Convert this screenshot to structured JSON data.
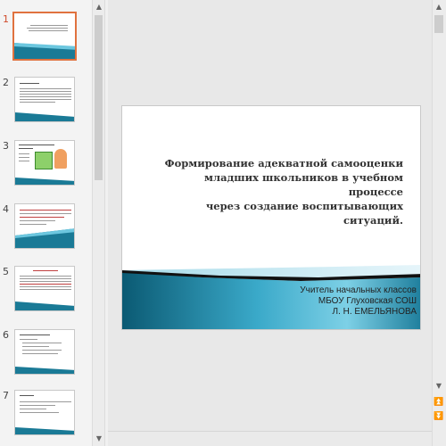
{
  "thumbnails": [
    {
      "number": "1",
      "active": true
    },
    {
      "number": "2",
      "active": false
    },
    {
      "number": "3",
      "active": false
    },
    {
      "number": "4",
      "active": false
    },
    {
      "number": "5",
      "active": false
    },
    {
      "number": "6",
      "active": false
    },
    {
      "number": "7",
      "active": false
    }
  ],
  "slide": {
    "title_line1": "Формирование адекватной самооценки",
    "title_line2": "младших школьников в учебном процессе",
    "title_line3": "через создание воспитывающих ситуаций.",
    "subtitle_line1": "Учитель начальных классов",
    "subtitle_line2": "МБОУ Глуховская СОШ",
    "subtitle_line3": "Л. Н. ЕМЕЛЬЯНОВА"
  },
  "scroll": {
    "up_arrow": "▲",
    "down_arrow": "▼",
    "prev_slide": "⏫",
    "next_slide": "⏬"
  },
  "colors": {
    "accent_active": "#e0723f",
    "wave_dark": "#0d5a72",
    "wave_light": "#5fc4e0"
  }
}
